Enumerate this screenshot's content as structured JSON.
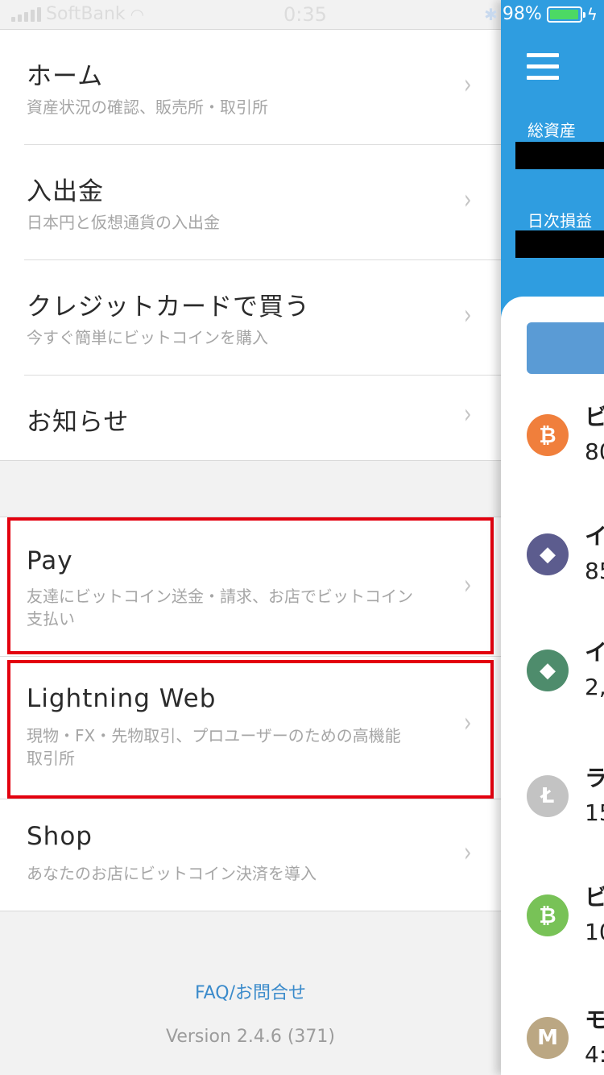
{
  "status_bar": {
    "carrier": "SoftBank",
    "time": "0:35",
    "battery_percent": "98%",
    "battery_level": 0.98,
    "icons": [
      "signal-icon",
      "wifi-icon",
      "bluetooth-icon",
      "battery-icon",
      "charging-icon"
    ]
  },
  "menu": {
    "items": [
      {
        "title": "ホーム",
        "subtitle": "資産状況の確認、販売所・取引所"
      },
      {
        "title": "入出金",
        "subtitle": "日本円と仮想通貨の入出金"
      },
      {
        "title": "クレジットカードで買う",
        "subtitle": "今すぐ簡単にビットコインを購入"
      },
      {
        "title": "お知らせ",
        "subtitle": ""
      }
    ],
    "items2": [
      {
        "title": "Pay",
        "subtitle": "友達にビットコイン送金・請求、お店でビットコイン支払い"
      },
      {
        "title": "Lightning Web",
        "subtitle": "現物・FX・先物取引、プロユーザーのための高機能取引所"
      },
      {
        "title": "Shop",
        "subtitle": "あなたのお店にビットコイン決済を導入"
      }
    ],
    "chevron": "›",
    "faq_link": "FAQ/お問合せ",
    "version": "Version 2.4.6 (371)"
  },
  "app_preview": {
    "total_assets_label": "総資産",
    "daily_pl_label": "日次損益",
    "coins": [
      {
        "symbol": "₿",
        "name_frag": "ビ",
        "value_frag": "80",
        "color": "#f07f3c",
        "icon": "bitcoin-icon"
      },
      {
        "symbol": "◆",
        "name_frag": "イ",
        "value_frag": "85",
        "color": "#5c5c8e",
        "icon": "ethereum-icon"
      },
      {
        "symbol": "◆",
        "name_frag": "イ",
        "value_frag": "2,",
        "color": "#4e8c6c",
        "icon": "ethereum-classic-icon"
      },
      {
        "symbol": "Ł",
        "name_frag": "ラ",
        "value_frag": "15",
        "color": "#c3c3c3",
        "icon": "litecoin-icon"
      },
      {
        "symbol": "₿",
        "name_frag": "ビ",
        "value_frag": "10",
        "color": "#78c257",
        "icon": "bitcoin-cash-icon"
      },
      {
        "symbol": "M",
        "name_frag": "モ",
        "value_frag": "4:",
        "color": "#bba783",
        "icon": "monacoin-icon"
      }
    ]
  }
}
